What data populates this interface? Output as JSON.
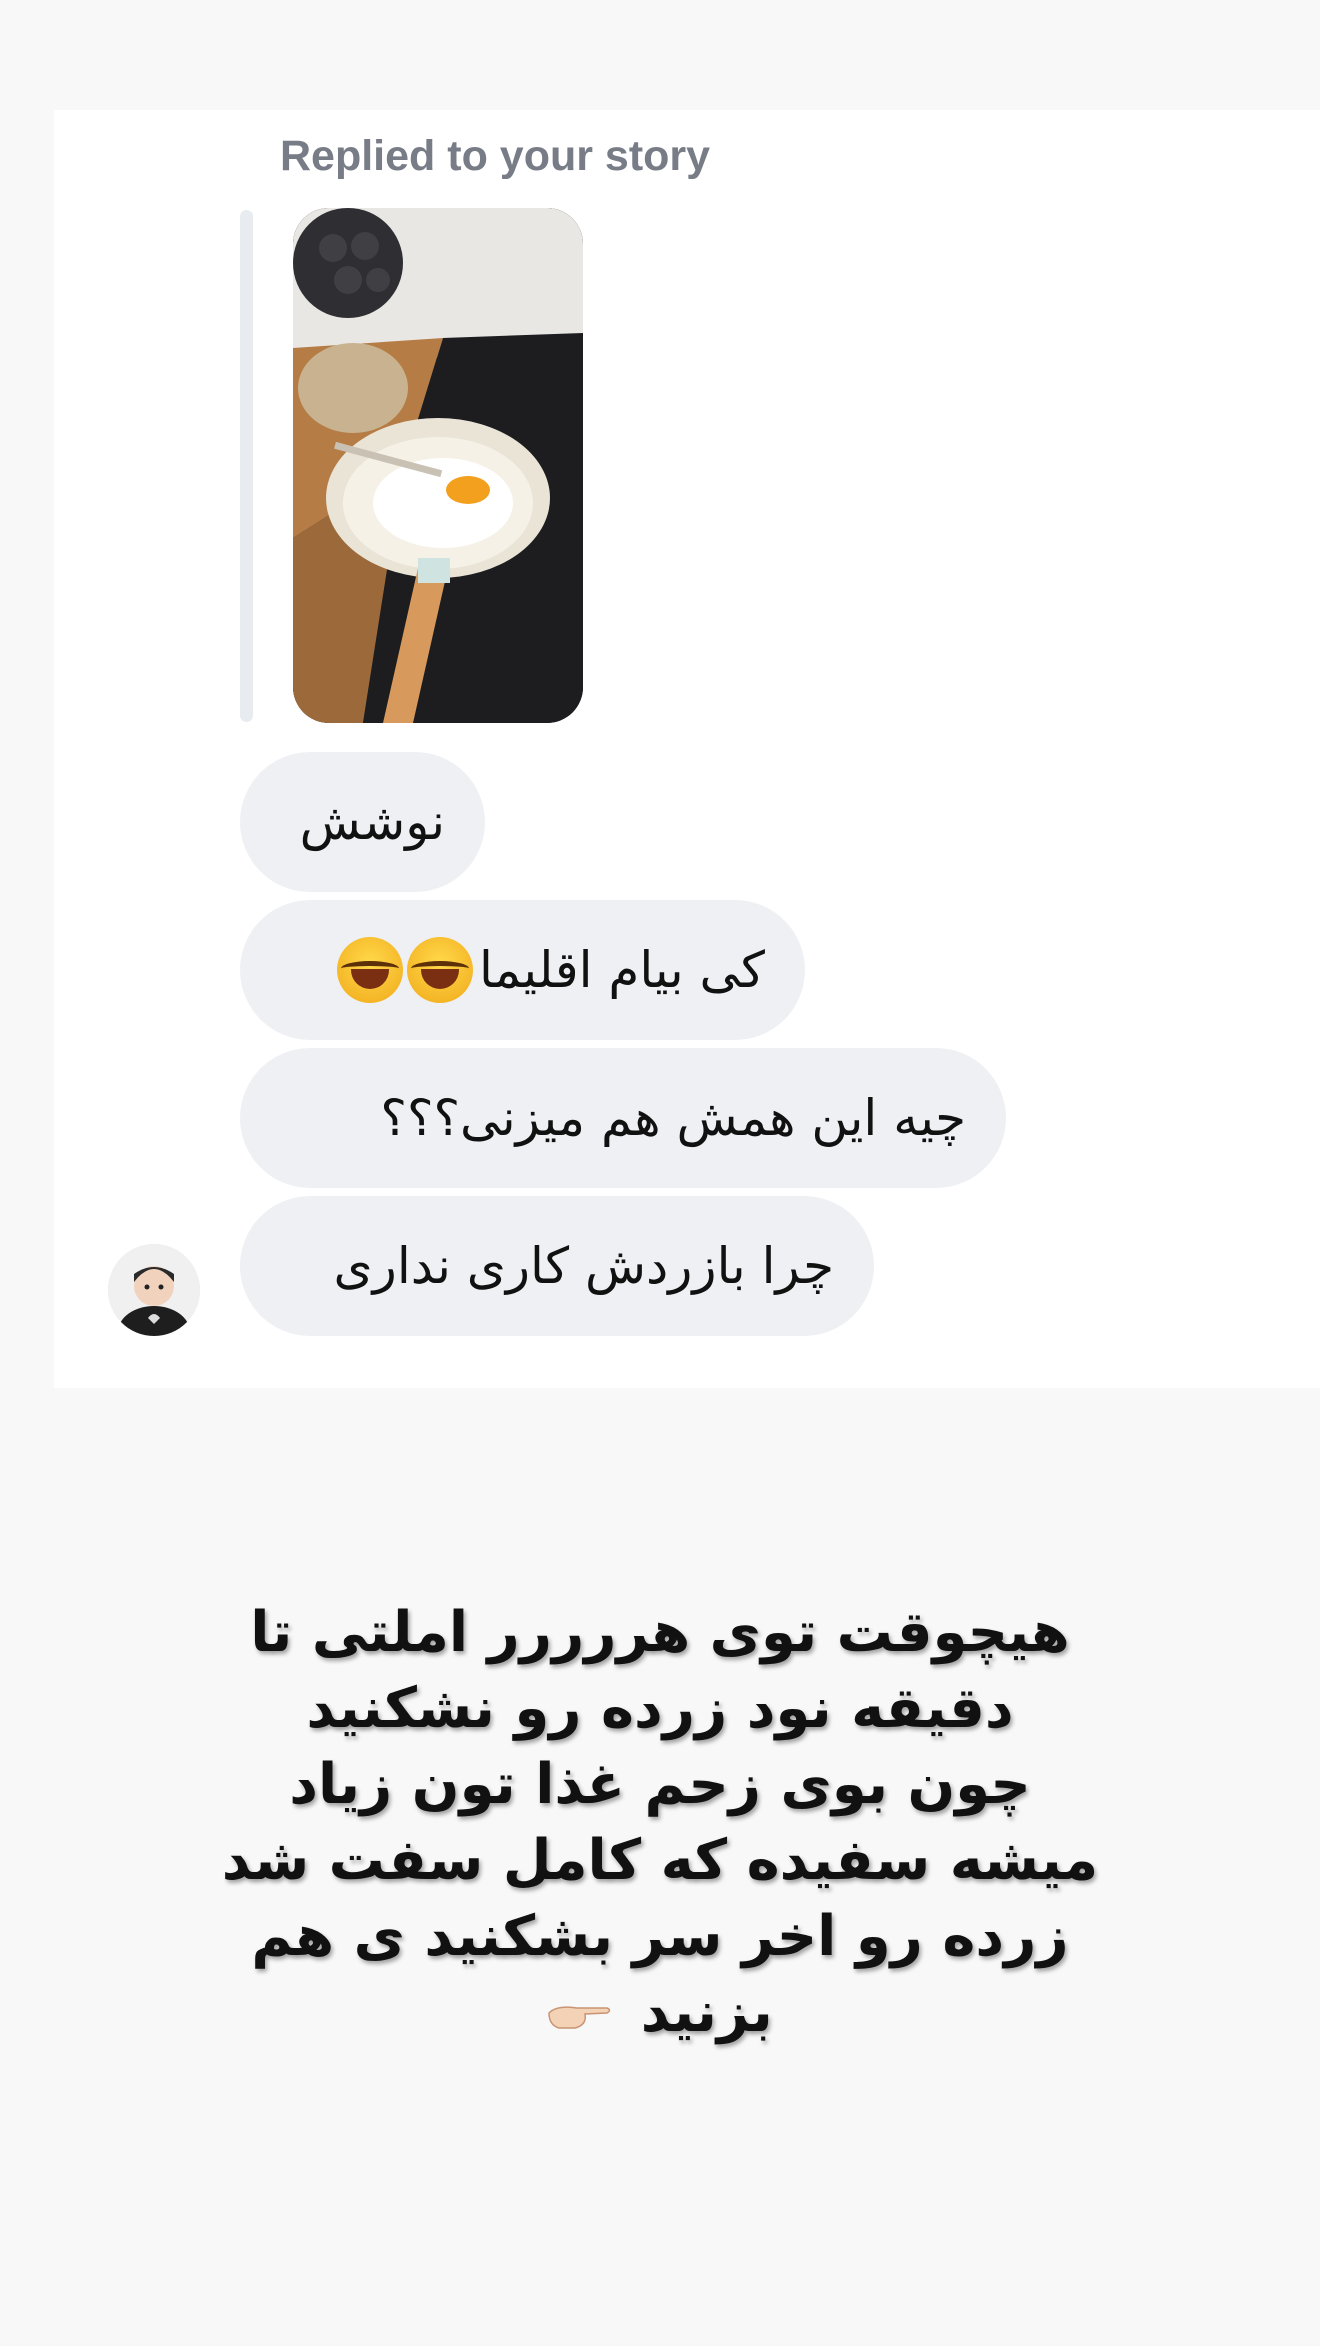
{
  "reply_header": "Replied to your story",
  "messages": [
    {
      "text": "نوشش"
    },
    {
      "text": "کی بیام اقلیما"
    },
    {
      "text": "چیه این همش هم میزنی؟؟؟"
    },
    {
      "text": "چرا بازردش کاری نداری"
    }
  ],
  "emoji": {
    "laugh_icon": "face-with-tears-of-joy",
    "count": 2
  },
  "caption": {
    "lines": [
      "هیچوقت توی هررررر املتی تا",
      "دقیقه نود زرده رو نشکنید",
      "چون بوی زحم غذا تون زیاد",
      "میشه سفیده که کامل سفت شد",
      "زرده رو اخر سر بشکنید ی هم",
      "بزنید"
    ],
    "trailing_icon": "pointing-hand-emoji"
  },
  "colors": {
    "bubble": "#eef0f3",
    "page_bg": "#f8f8f8",
    "card_bg": "#ffffff",
    "muted_text": "#777c86"
  }
}
